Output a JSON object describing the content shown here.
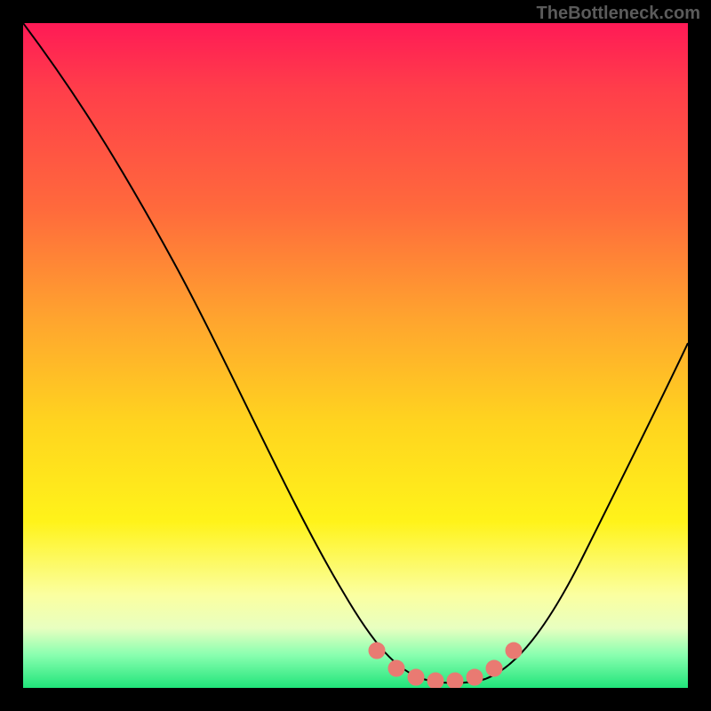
{
  "watermark_text": "TheBottleneck.com",
  "chart_data": {
    "type": "line",
    "title": "",
    "xlabel": "",
    "ylabel": "",
    "xlim": [
      0,
      100
    ],
    "ylim": [
      0,
      100
    ],
    "grid": false,
    "legend": false,
    "series": [
      {
        "name": "bottleneck-curve",
        "x": [
          0,
          12,
          24,
          36,
          48,
          54,
          58,
          62,
          66,
          70,
          74,
          80,
          86,
          92,
          100
        ],
        "y": [
          100,
          88,
          74,
          56,
          30,
          14,
          6,
          2,
          1,
          1,
          2,
          6,
          16,
          30,
          48
        ]
      }
    ],
    "markers": {
      "name": "optimal-zone",
      "x": [
        53,
        56,
        59,
        62,
        65,
        68,
        71,
        74
      ],
      "y": [
        5,
        3,
        2,
        1.5,
        1.5,
        2,
        3,
        5
      ]
    },
    "gradient_colors": {
      "top": "#ff1a56",
      "mid_warm": "#ffd41f",
      "bottom": "#20e47a"
    }
  }
}
